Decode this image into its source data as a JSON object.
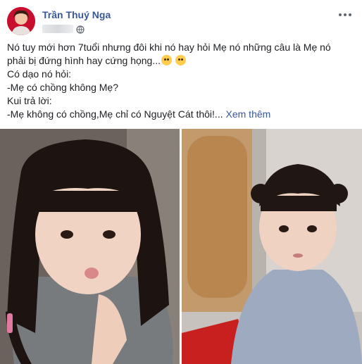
{
  "post": {
    "author_name": "Trần Thuý Nga",
    "privacy_icon": "globe-icon",
    "more_icon": "more-options-icon",
    "lines": [
      "Nó tuy mới hơn 7tuổi nhưng đôi khi nó hay hỏi Mẹ nó những câu là Mẹ nó",
      "phải bị đứng hình hay cứng họng...",
      "Có dạo nó hỏi:",
      "-Mẹ có chồng không Mẹ?",
      "Kui trả lời:",
      "-Mẹ không có chồng,Mẹ chỉ có Nguyệt Cát thôi!..."
    ],
    "see_more": "Xem thêm",
    "emojis": [
      "rolling-eyes-emoji",
      "sad-emoji"
    ]
  },
  "photos": [
    {
      "name": "photo-girl-kissing-face",
      "bg": "#6e6560"
    },
    {
      "name": "photo-girl-traditional-dress",
      "bg": "#b0aca8"
    }
  ],
  "colors": {
    "link": "#385898",
    "text": "#1c1e21",
    "meta": "#606770"
  }
}
